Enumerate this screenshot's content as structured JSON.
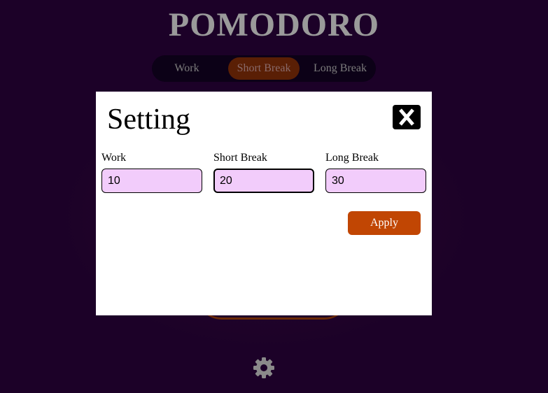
{
  "app": {
    "title": "POMODORO"
  },
  "mode_tabs": [
    {
      "label": "Work",
      "active": false
    },
    {
      "label": "Short Break",
      "active": true
    },
    {
      "label": "Long Break",
      "active": false
    }
  ],
  "settings_modal": {
    "title": "Setting",
    "close_icon": "close-x-icon",
    "fields": [
      {
        "label": "Work",
        "value": "10"
      },
      {
        "label": "Short Break",
        "value": "20"
      },
      {
        "label": "Long Break",
        "value": "30"
      }
    ],
    "apply_label": "Apply"
  },
  "footer": {
    "settings_icon": "gear-icon"
  },
  "colors": {
    "background": "#1c0128",
    "accent": "#c14603",
    "input_bg": "#f2ccfb",
    "title_gray": "#9a9a9a"
  }
}
